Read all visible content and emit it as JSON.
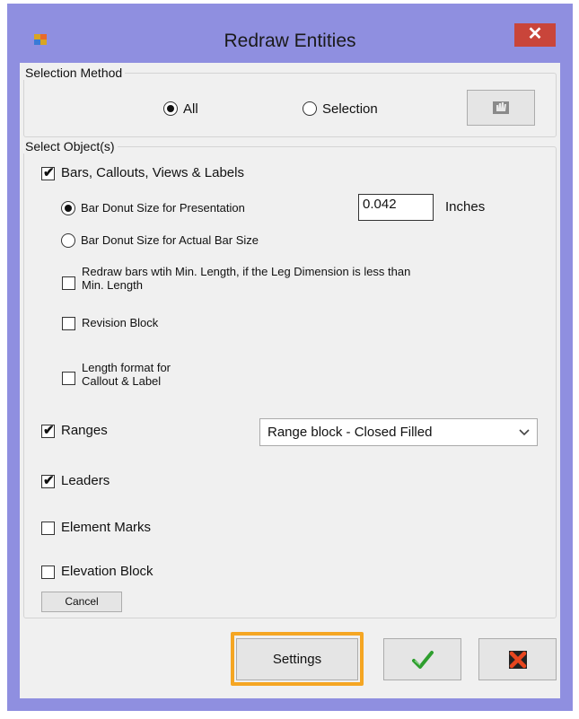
{
  "window": {
    "title": "Redraw Entities",
    "close_glyph": "✕"
  },
  "selection_method": {
    "legend": "Selection Method",
    "all_label": "All",
    "selection_label": "Selection",
    "selected": "All"
  },
  "objects": {
    "legend": "Select Object(s)",
    "bars_label": "Bars, Callouts, Views & Labels",
    "bars_checked": true,
    "donut_presentation_label": "Bar Donut Size for Presentation",
    "donut_presentation_selected": true,
    "donut_value": "0.042",
    "donut_unit": "Inches",
    "donut_actual_label": "Bar Donut Size for Actual Bar Size",
    "redraw_min_line1": "Redraw bars wtih Min. Length, if the Leg Dimension is less than",
    "redraw_min_line2": "Min. Length",
    "revision_block_label": "Revision Block",
    "length_format_line1": "Length format for",
    "length_format_line2": "Callout & Label",
    "ranges_label": "Ranges",
    "ranges_checked": true,
    "range_style_value": "Range block - Closed Filled",
    "leaders_label": "Leaders",
    "leaders_checked": true,
    "element_marks_label": "Element Marks",
    "elevation_block_label": "Elevation Block",
    "cancel_label": "Cancel"
  },
  "footer": {
    "settings_label": "Settings",
    "ok_icon": "check-icon",
    "cancel_icon": "x-icon",
    "highlight_color": "#f5a623"
  }
}
